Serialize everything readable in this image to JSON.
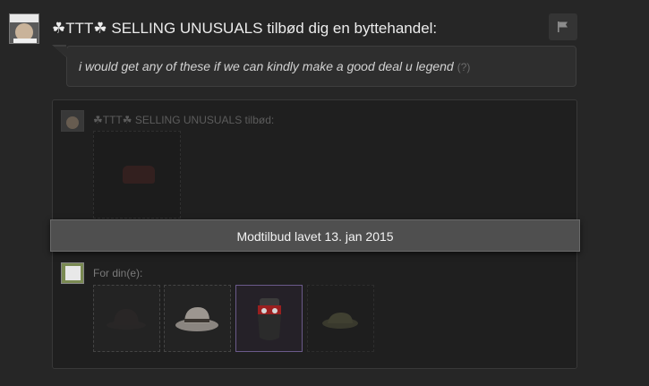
{
  "header": {
    "title": "☘TTT☘ SELLING UNUSUALS tilbød dig en byttehandel:"
  },
  "message": {
    "text": "i would get any of these if we can kindly make a good deal u legend",
    "help": "(?)"
  },
  "partner": {
    "label": "☘TTT☘ SELLING UNUSUALS tilbød:"
  },
  "banner": {
    "text": "Modtilbud lavet 13. jan 2015"
  },
  "mine": {
    "label": "For din(e):"
  },
  "icons": {
    "flag": "flag-icon"
  },
  "colors": {
    "background": "#262626",
    "panel": "#1f1f1f",
    "banner": "#4f4f4f",
    "selected_border": "#6a5a8a"
  }
}
